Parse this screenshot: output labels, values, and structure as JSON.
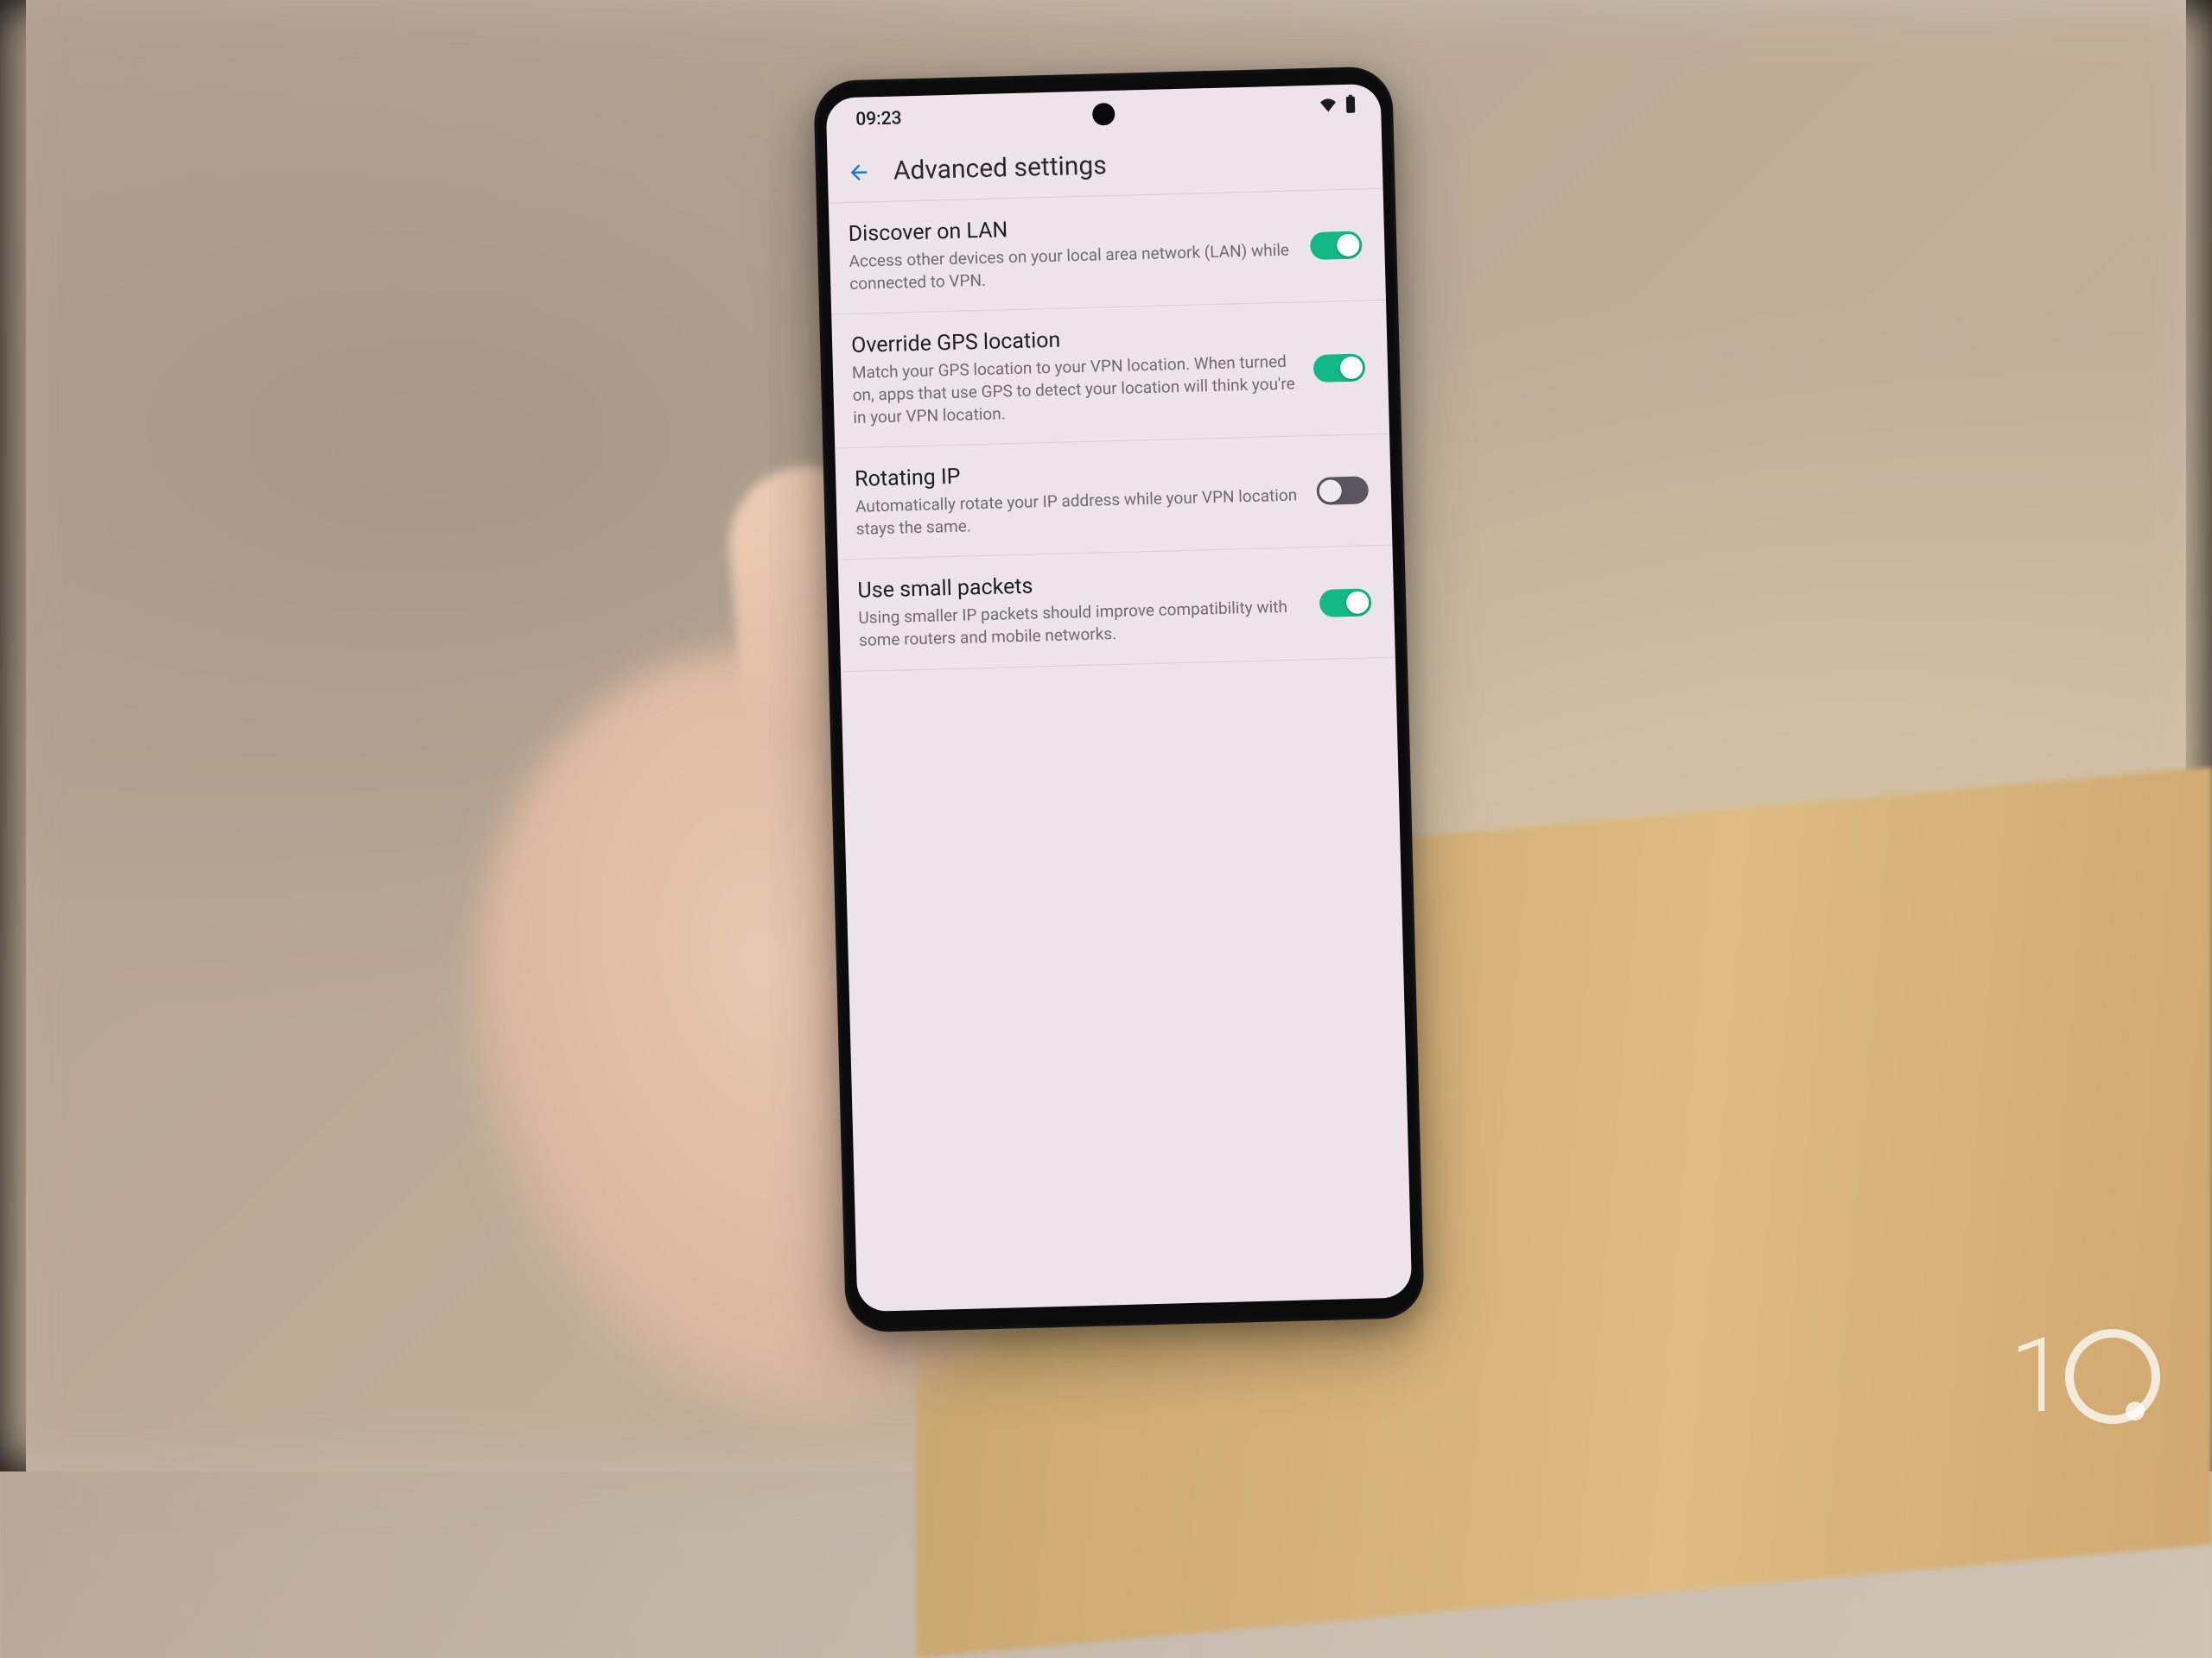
{
  "status_bar": {
    "time": "09:23"
  },
  "app_bar": {
    "title": "Advanced settings"
  },
  "settings": [
    {
      "key": "discover-lan",
      "title": "Discover on LAN",
      "description": "Access other devices on your local area network (LAN) while connected to VPN.",
      "enabled": true
    },
    {
      "key": "override-gps",
      "title": "Override GPS location",
      "description": "Match your GPS location to your VPN location. When turned on, apps that use GPS to detect your location will think you're in your VPN location.",
      "enabled": true
    },
    {
      "key": "rotating-ip",
      "title": "Rotating IP",
      "description": "Automatically rotate your IP address while your VPN location stays the same.",
      "enabled": false
    },
    {
      "key": "small-packets",
      "title": "Use small packets",
      "description": "Using smaller IP packets should improve compatibility with some routers and mobile networks.",
      "enabled": true
    }
  ],
  "watermark": {
    "digit": "1"
  },
  "colors": {
    "toggle_on": "#12b886",
    "toggle_off": "#5a5660",
    "back_arrow": "#1976d2",
    "screen_bg": "#ede4ea"
  }
}
